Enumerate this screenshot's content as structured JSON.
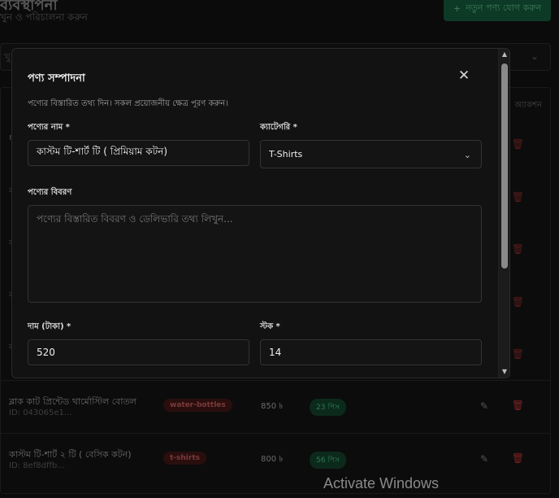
{
  "background": {
    "title_fragment": "ব্যবস্থাপনা",
    "subtitle_fragment": "খুন ও পরিচালনা করুন",
    "add_button_label": "নতুন পণ্য যোগ করুন",
    "search_fragment": "খু",
    "action_header": "অ্যাকশন",
    "row_fragments": [
      "rod",
      "কা",
      "কা",
      "কা",
      "কা"
    ],
    "rows": [
      {
        "name": "ব্লাক কাট প্রিন্টেড থার্মোস্টিল বোতল",
        "id": "ID: 043065e1...",
        "category": "water-bottles",
        "price": "850 ৳",
        "stock": "23 পিস"
      },
      {
        "name": "কাস্টম টি-শার্ট ২ টি ( বেসিক কটন)",
        "id": "ID: 8ef8dffb...",
        "category": "t-shirts",
        "price": "800 ৳",
        "stock": "56 পিস"
      }
    ],
    "watermark": "Activate Windows"
  },
  "modal": {
    "title": "পণ্য সম্পাদনা",
    "description": "পণ্যের বিস্তারিত তথ্য দিন। সকল প্রয়োজনীয় ক্ষেত্র পূরণ করুন।",
    "name_label": "পণ্যের নাম *",
    "name_value": "কাস্টম টি-শার্ট টি ( প্রিমিয়াম কটন)",
    "category_label": "ক্যাটেগরি *",
    "category_value": "T-Shirts",
    "description_label": "পণ্যের বিবরণ",
    "description_placeholder": "পণ্যের বিস্তারিত বিবরণ ও ডেলিভারি তথ্য লিখুন...",
    "price_label": "দাম (টাকা) *",
    "price_value": "520",
    "stock_label": "স্টক *",
    "stock_value": "14"
  },
  "icons": {
    "close": "close-icon",
    "chevron": "chevron-down-icon",
    "edit": "pencil-icon",
    "delete": "trash-icon",
    "plus": "plus-icon"
  }
}
